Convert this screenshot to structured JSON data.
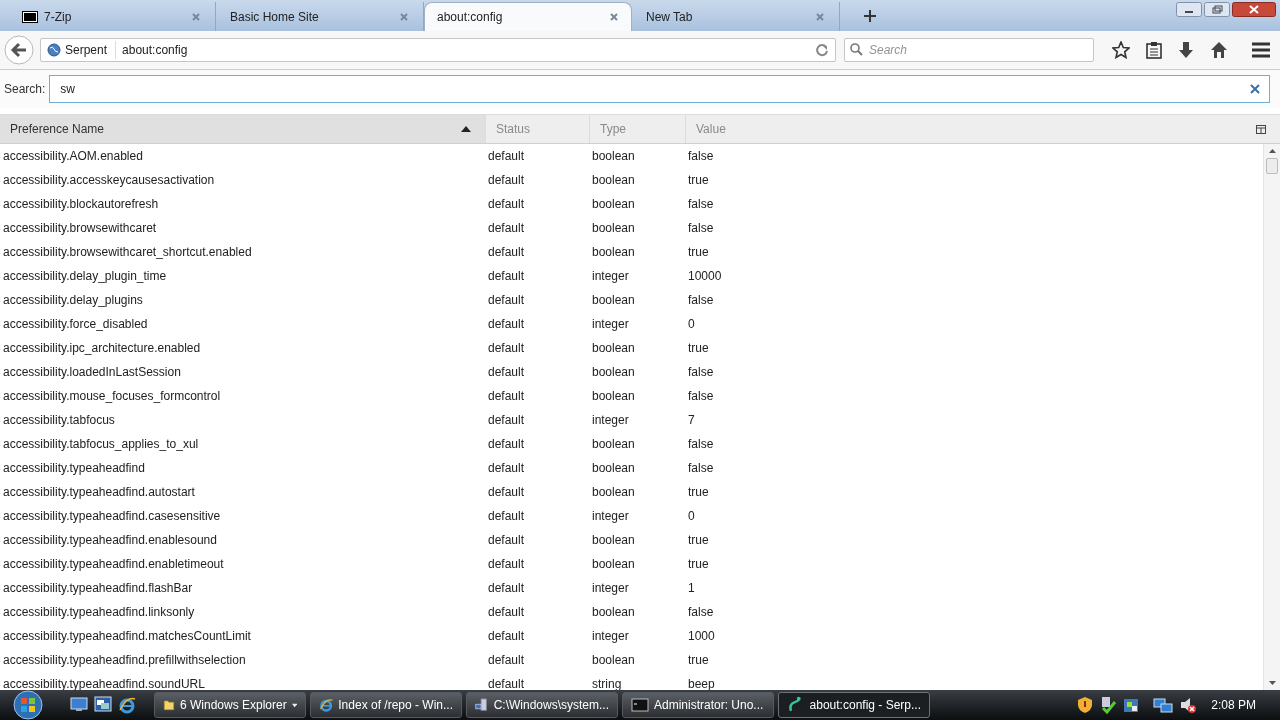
{
  "tabs": [
    {
      "label": "7-Zip",
      "selected": false
    },
    {
      "label": "Basic Home Site",
      "selected": false
    },
    {
      "label": "about:config",
      "selected": true
    },
    {
      "label": "New Tab",
      "selected": false
    }
  ],
  "nav": {
    "identity": "Serpent",
    "url": "about:config",
    "search_placeholder": "Search"
  },
  "config_search": {
    "label": "Search:",
    "value": "sw"
  },
  "table": {
    "columns": [
      {
        "label": "Preference Name",
        "sorted": true
      },
      {
        "label": "Status",
        "sorted": false
      },
      {
        "label": "Type",
        "sorted": false
      },
      {
        "label": "Value",
        "sorted": false
      }
    ],
    "rows": [
      [
        "accessibility.AOM.enabled",
        "default",
        "boolean",
        "false"
      ],
      [
        "accessibility.accesskeycausesactivation",
        "default",
        "boolean",
        "true"
      ],
      [
        "accessibility.blockautorefresh",
        "default",
        "boolean",
        "false"
      ],
      [
        "accessibility.browsewithcaret",
        "default",
        "boolean",
        "false"
      ],
      [
        "accessibility.browsewithcaret_shortcut.enabled",
        "default",
        "boolean",
        "true"
      ],
      [
        "accessibility.delay_plugin_time",
        "default",
        "integer",
        "10000"
      ],
      [
        "accessibility.delay_plugins",
        "default",
        "boolean",
        "false"
      ],
      [
        "accessibility.force_disabled",
        "default",
        "integer",
        "0"
      ],
      [
        "accessibility.ipc_architecture.enabled",
        "default",
        "boolean",
        "true"
      ],
      [
        "accessibility.loadedInLastSession",
        "default",
        "boolean",
        "false"
      ],
      [
        "accessibility.mouse_focuses_formcontrol",
        "default",
        "boolean",
        "false"
      ],
      [
        "accessibility.tabfocus",
        "default",
        "integer",
        "7"
      ],
      [
        "accessibility.tabfocus_applies_to_xul",
        "default",
        "boolean",
        "false"
      ],
      [
        "accessibility.typeaheadfind",
        "default",
        "boolean",
        "false"
      ],
      [
        "accessibility.typeaheadfind.autostart",
        "default",
        "boolean",
        "true"
      ],
      [
        "accessibility.typeaheadfind.casesensitive",
        "default",
        "integer",
        "0"
      ],
      [
        "accessibility.typeaheadfind.enablesound",
        "default",
        "boolean",
        "true"
      ],
      [
        "accessibility.typeaheadfind.enabletimeout",
        "default",
        "boolean",
        "true"
      ],
      [
        "accessibility.typeaheadfind.flashBar",
        "default",
        "integer",
        "1"
      ],
      [
        "accessibility.typeaheadfind.linksonly",
        "default",
        "boolean",
        "false"
      ],
      [
        "accessibility.typeaheadfind.matchesCountLimit",
        "default",
        "integer",
        "1000"
      ],
      [
        "accessibility.typeaheadfind.prefillwithselection",
        "default",
        "boolean",
        "true"
      ],
      [
        "accessibility.typeaheadfind.soundURL",
        "default",
        "string",
        "beep"
      ]
    ]
  },
  "taskbar": {
    "items": [
      {
        "label": "6 Windows Explorer",
        "kind": "folder",
        "selected": false
      },
      {
        "label": "Index of /repo - Win...",
        "kind": "browser",
        "selected": false
      },
      {
        "label": "C:\\Windows\\system...",
        "kind": "computer",
        "selected": false
      },
      {
        "label": "Administrator:  Uno...",
        "kind": "console",
        "selected": false
      },
      {
        "label": "about:config - Serp...",
        "kind": "serpent",
        "selected": true
      }
    ],
    "clock": "2:08 PM"
  }
}
